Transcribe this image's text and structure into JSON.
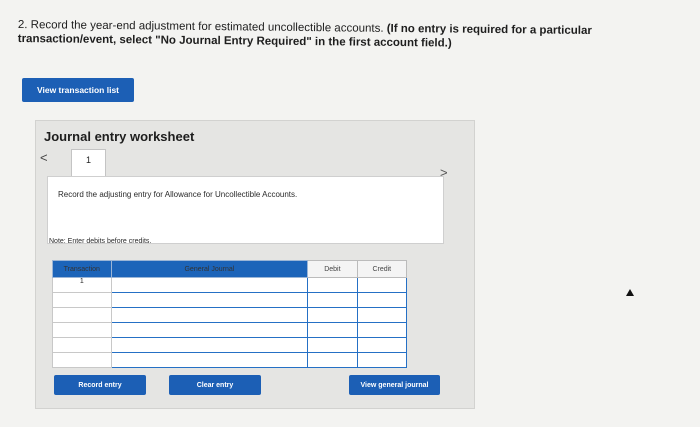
{
  "instructions": {
    "part1": "2. Record the year-end adjustment for estimated uncollectible accounts. ",
    "part2": "(If no entry is required for a particular transaction/event, select \"No Journal Entry Required\" in the first account field.)"
  },
  "buttons": {
    "view_transaction_list": "View transaction list",
    "record_entry": "Record entry",
    "clear_entry": "Clear entry",
    "view_general_journal": "View general journal"
  },
  "worksheet": {
    "title": "Journal entry worksheet",
    "prev": "<",
    "next": ">",
    "tab_number": "1",
    "description": "Record the adjusting entry for Allowance for Uncollectible Accounts.",
    "note": "Note: Enter debits before credits."
  },
  "table": {
    "headers": [
      "Transaction",
      "General Journal",
      "Debit",
      "Credit"
    ],
    "rows": [
      {
        "transaction": "1"
      },
      {
        "transaction": ""
      },
      {
        "transaction": ""
      },
      {
        "transaction": ""
      },
      {
        "transaction": ""
      },
      {
        "transaction": ""
      }
    ]
  },
  "colors": {
    "accent": "#1c5fb5"
  }
}
